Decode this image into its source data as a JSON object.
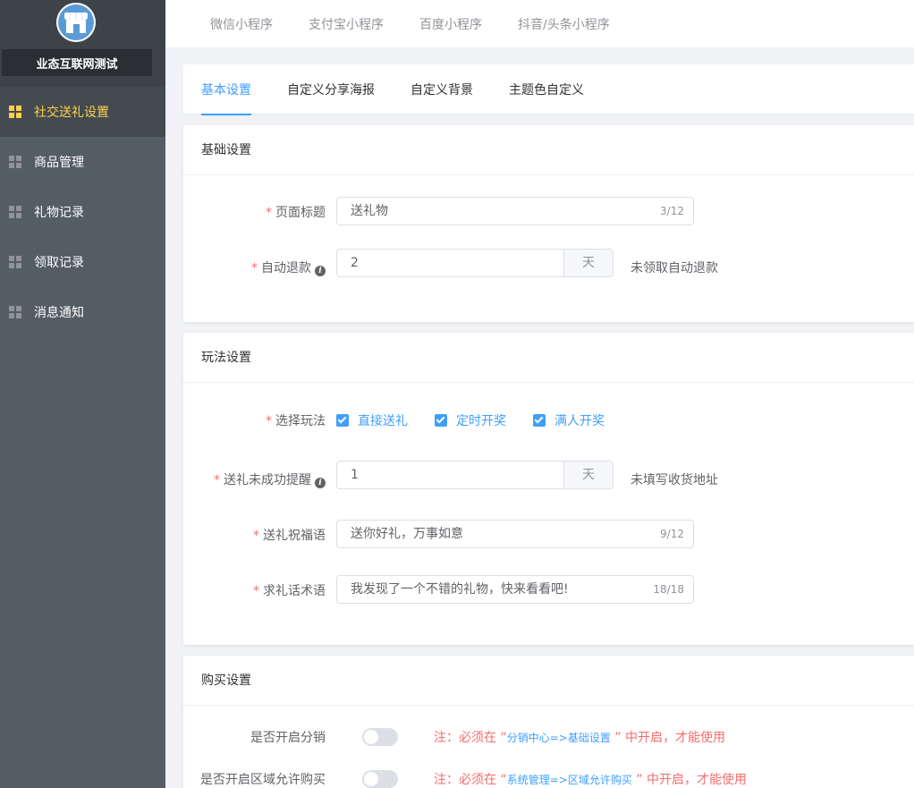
{
  "sidebar": {
    "logo": "shop-icon",
    "brand": "业态互联网测试",
    "items": [
      {
        "label": "社交送礼设置",
        "active": true
      },
      {
        "label": "商品管理",
        "active": false
      },
      {
        "label": "礼物记录",
        "active": false
      },
      {
        "label": "领取记录",
        "active": false
      },
      {
        "label": "消息通知",
        "active": false
      }
    ]
  },
  "platform_tabs": [
    "微信小程序",
    "支付宝小程序",
    "百度小程序",
    "抖音/头条小程序"
  ],
  "settings_tabs": [
    {
      "label": "基本设置",
      "active": true
    },
    {
      "label": "自定义分享海报",
      "active": false
    },
    {
      "label": "自定义背景",
      "active": false
    },
    {
      "label": "主题色自定义",
      "active": false
    }
  ],
  "basic": {
    "header": "基础设置",
    "page_title": {
      "label": "页面标题",
      "value": "送礼物",
      "count": "3/12"
    },
    "auto_refund": {
      "label": "自动退款",
      "value": "2",
      "unit": "天",
      "hint": "未领取自动退款"
    }
  },
  "play": {
    "header": "玩法设置",
    "mode": {
      "label": "选择玩法",
      "options": [
        "直接送礼",
        "定时开奖",
        "满人开奖"
      ]
    },
    "remind": {
      "label": "送礼未成功提醒",
      "value": "1",
      "unit": "天",
      "hint": "未填写收货地址"
    },
    "blessing": {
      "label": "送礼祝福语",
      "value": "送你好礼，万事如意",
      "count": "9/12"
    },
    "ask": {
      "label": "求礼话术语",
      "value": "我发现了一个不错的礼物，快来看看吧!",
      "count": "18/18"
    }
  },
  "buy": {
    "header": "购买设置",
    "distribution": {
      "label": "是否开启分销",
      "note_prefix": "注：必须在 “",
      "note_link": "分销中心=>基础设置",
      "note_suffix": " ” 中开启，才能使用"
    },
    "region": {
      "label": "是否开启区域允许购买",
      "note_prefix": "注：必须在 “",
      "note_link": "系统管理=>区域允许购买",
      "note_suffix": " ” 中开启，才能使用"
    }
  },
  "colors": {
    "primary": "#409eff",
    "sidebar_bg": "#545c64",
    "active_text": "#ffd04b",
    "danger": "#f56c6c"
  }
}
